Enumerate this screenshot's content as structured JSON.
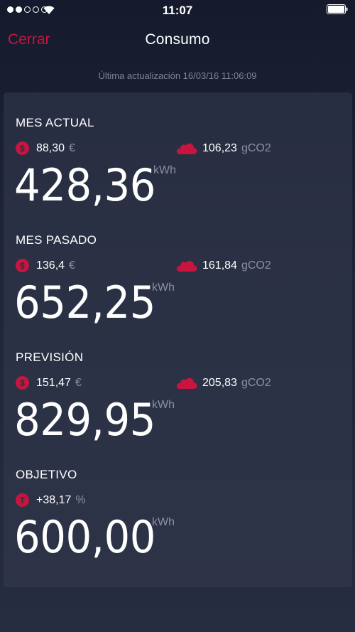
{
  "status_bar": {
    "time": "11:07",
    "signal_dots_filled": 2,
    "signal_dots_total": 5
  },
  "nav": {
    "close_label": "Cerrar",
    "title": "Consumo"
  },
  "last_update": "Última actualización 16/03/16 11:06:09",
  "colors": {
    "accent": "#c8153f",
    "background_top": "#151a2c",
    "background_bottom": "#272d41",
    "muted_text": "#8a90a2"
  },
  "sections": [
    {
      "title": "MES ACTUAL",
      "cost": {
        "icon": "dollar-coin-icon",
        "glyph": "$",
        "value": "88,30",
        "unit": "€"
      },
      "emissions": {
        "icon": "cloud-icon",
        "value": "106,23",
        "unit": "gCO2"
      },
      "energy": {
        "value": "428,36",
        "unit": "kWh"
      }
    },
    {
      "title": "MES PASADO",
      "cost": {
        "icon": "dollar-coin-icon",
        "glyph": "$",
        "value": "136,4",
        "unit": "€"
      },
      "emissions": {
        "icon": "cloud-icon",
        "value": "161,84",
        "unit": "gCO2"
      },
      "energy": {
        "value": "652,25",
        "unit": "kWh"
      }
    },
    {
      "title": "PREVISIÓN",
      "cost": {
        "icon": "dollar-coin-icon",
        "glyph": "$",
        "value": "151,47",
        "unit": "€"
      },
      "emissions": {
        "icon": "cloud-icon",
        "value": "205,83",
        "unit": "gCO2"
      },
      "energy": {
        "value": "829,95",
        "unit": "kWh"
      }
    },
    {
      "title": "OBJETIVO",
      "target": {
        "icon": "target-coin-icon",
        "glyph": "T",
        "value": "+38,17",
        "unit": "%"
      },
      "energy": {
        "value": "600,00",
        "unit": "kWh"
      }
    }
  ]
}
